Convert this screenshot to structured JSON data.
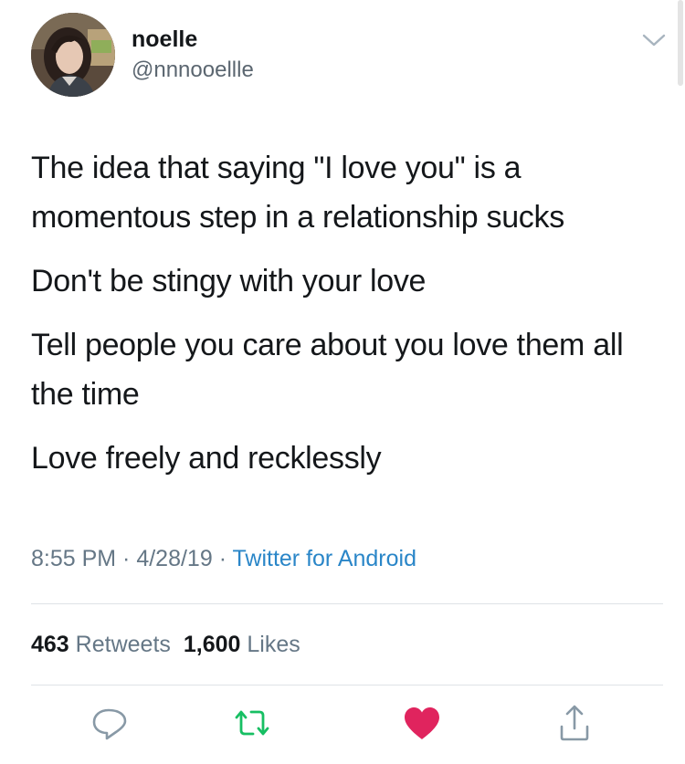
{
  "author": {
    "display_name": "noelle",
    "handle": "@nnnooellle"
  },
  "tweet": {
    "paragraphs": [
      "The idea that saying \"I love you\" is a momentous step in a relationship sucks",
      "Don't be stingy with your love",
      "Tell people you care about you love them all the time",
      "Love freely and recklessly"
    ]
  },
  "meta": {
    "time": "8:55 PM",
    "sep1": " · ",
    "date": "4/28/19",
    "sep2": " · ",
    "source": "Twitter for Android"
  },
  "stats": {
    "retweets_count": "463",
    "retweets_label": "Retweets",
    "likes_count": "1,600",
    "likes_label": "Likes"
  },
  "icons": {
    "menu": "chevron-down-icon",
    "reply": "reply-icon",
    "retweet": "retweet-icon",
    "like": "heart-icon",
    "share": "share-icon"
  },
  "colors": {
    "link": "#2a86c8",
    "muted": "#657786",
    "retweet_green": "#17bf63",
    "like_red": "#e0245e"
  }
}
